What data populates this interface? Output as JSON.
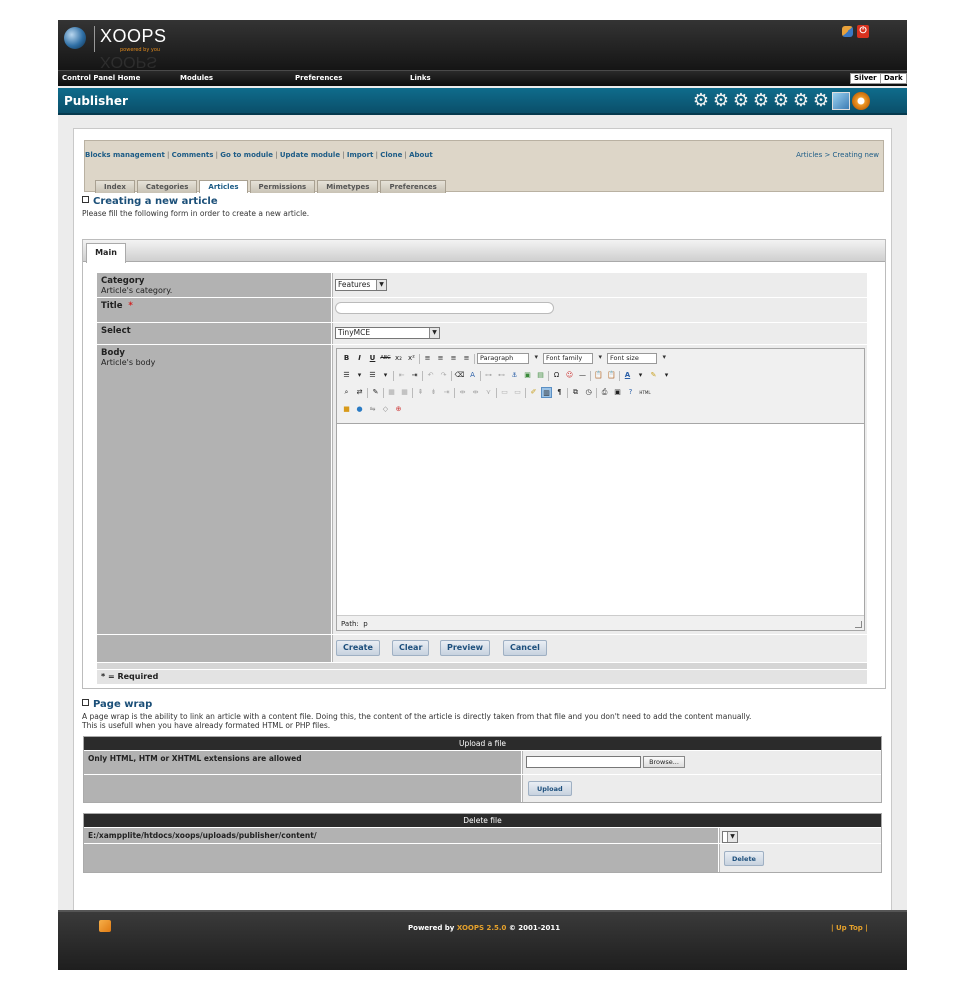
{
  "header": {
    "logo_text": "XOOPS",
    "logo_sub": "powered by you",
    "logo_reflection": "XOOPS"
  },
  "menubar": {
    "items": [
      "Control Panel Home",
      "Modules",
      "Preferences",
      "Links"
    ],
    "themes": [
      "Silver",
      "Dark"
    ]
  },
  "module": {
    "title": "Publisher"
  },
  "adminnav": {
    "links": [
      "Blocks management",
      "Comments",
      "Go to module",
      "Update module",
      "Import",
      "Clone",
      "About"
    ],
    "breadcrumb": "Articles > Creating new",
    "tabs": [
      "Index",
      "Categories",
      "Articles",
      "Permissions",
      "Mimetypes",
      "Preferences"
    ],
    "active_tab": "Articles"
  },
  "create": {
    "title": "Creating a new article",
    "description": "Please fill the following form in order to create a new article.",
    "main_tab": "Main",
    "fields": {
      "category_label": "Category",
      "category_help": "Article's category.",
      "category_value": "Features",
      "title_label": "Title",
      "required_star": "*",
      "select_label": "Select",
      "select_value": "TinyMCE",
      "body_label": "Body",
      "body_help": "Article's body"
    },
    "editor": {
      "paragraph": "Paragraph",
      "font_family": "Font family",
      "font_size": "Font size",
      "path_label": "Path:",
      "path_value": "p"
    },
    "buttons": [
      "Create",
      "Clear",
      "Preview",
      "Cancel"
    ],
    "required_note": "* = Required"
  },
  "pagewrap": {
    "title": "Page wrap",
    "description_line1": "A page wrap is the ability to link an article with a content file. Doing this, the content of the article is directly taken from that file and you don't need to add the content manually.",
    "description_line2": "This is usefull when you have already formated HTML or PHP files.",
    "upload": {
      "header": "Upload a file",
      "label": "Only HTML, HTM or XHTML extensions are allowed",
      "browse": "Browse...",
      "button": "Upload"
    },
    "delete": {
      "header": "Delete file",
      "path": "E:/xampplite/htdocs/xoops/uploads/publisher/content/",
      "button": "Delete"
    }
  },
  "footer": {
    "powered_prefix": "Powered by ",
    "powered_brand": "XOOPS 2.5.0",
    "powered_suffix": " © 2001-2011",
    "uptop": "| Up Top |"
  }
}
